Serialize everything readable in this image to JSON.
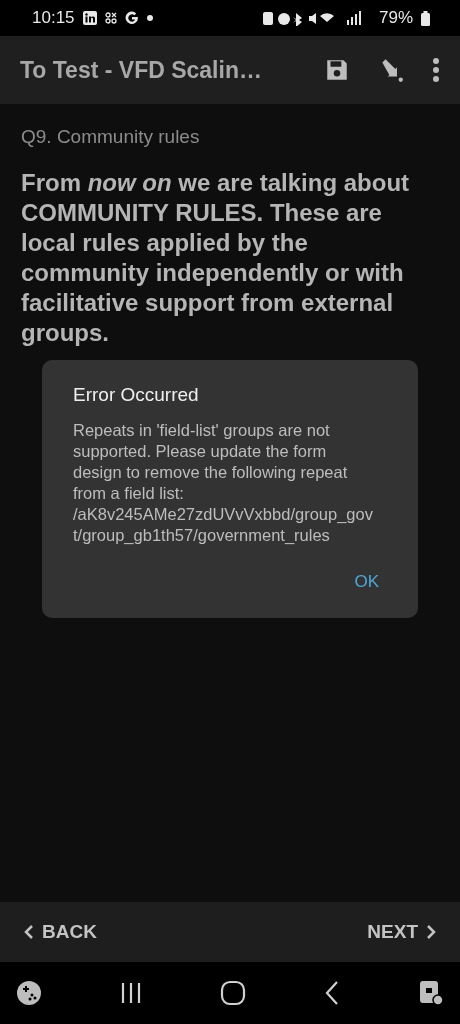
{
  "status_bar": {
    "time": "10:15",
    "battery": "79%"
  },
  "app_bar": {
    "title": "To Test - VFD Scalin…"
  },
  "question": {
    "label": "Q9. Community rules",
    "text": "From *now on* we are talking about COMMUNITY RULES. These are local rules applied by the community independently or with facilitative support from external groups."
  },
  "dialog": {
    "title": "Error Occurred",
    "message": "Repeats in 'field-list' groups are not supported. Please update the form design to remove the following repeat from a field list: /aK8v245AMe27zdUVvVxbbd/group_govt/group_gb1th57/government_rules",
    "button": "OK"
  },
  "bottom_bar": {
    "back": "BACK",
    "next": "NEXT"
  }
}
